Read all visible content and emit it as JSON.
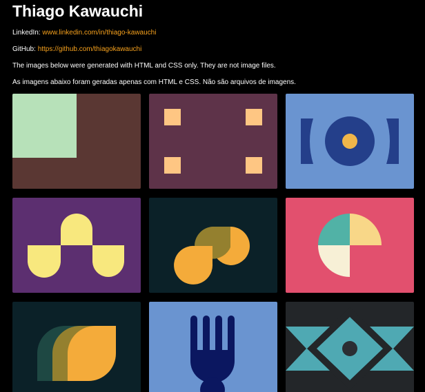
{
  "header": {
    "title": "Thiago Kawauchi"
  },
  "info": {
    "linkedin_label": "LinkedIn:",
    "linkedin_url": "www.linkedin.com/in/thiago-kawauchi",
    "github_label": "GitHub:",
    "github_url": "https://github.com/thiagokawauchi",
    "note_en": "The images below were generated with HTML and CSS only. They are not image files.",
    "note_pt": "As imagens abaixo foram geradas apenas com HTML e CSS. Não são arquivos de imagens."
  },
  "colors": {
    "background": "#000000",
    "link": "#f6a11d",
    "tile1_bg": "#5a3733",
    "tile1_square": "#b7e1b9",
    "tile2_bg": "#5e3349",
    "tile2_squares": "#fec683",
    "tile3_bg": "#6a94d0",
    "tile3_navy": "#243f8a",
    "tile3_dot": "#f0b64a",
    "tile4_bg": "#5c2f70",
    "tile4_shape": "#f8e87e",
    "tile5_bg": "#0b2128",
    "tile5_orange": "#f4ab3a",
    "tile5_olive": "#94802f",
    "tile6_bg": "#e2506e",
    "tile6_teal": "#51b2a6",
    "tile6_yellow": "#f8d788",
    "tile6_cream": "#f7f0d6",
    "tile7_bg": "#0b2128",
    "tile7_dark": "#1e4843",
    "tile7_olive": "#94802f",
    "tile7_orange": "#f4ab3a",
    "tile8_bg": "#6a94d0",
    "tile8_fork": "#0b1760",
    "tile9_bg": "#232629",
    "tile9_teal": "#4fa9b3",
    "tile9_dot": "#2b2e33"
  },
  "tiles": [
    {
      "icon": "square-corner-art"
    },
    {
      "icon": "four-squares-art"
    },
    {
      "icon": "ring-with-dot-art"
    },
    {
      "icon": "arches-art"
    },
    {
      "icon": "drops-art"
    },
    {
      "icon": "quarter-circles-art"
    },
    {
      "icon": "leaves-art"
    },
    {
      "icon": "fork-art"
    },
    {
      "icon": "diamond-art"
    }
  ]
}
